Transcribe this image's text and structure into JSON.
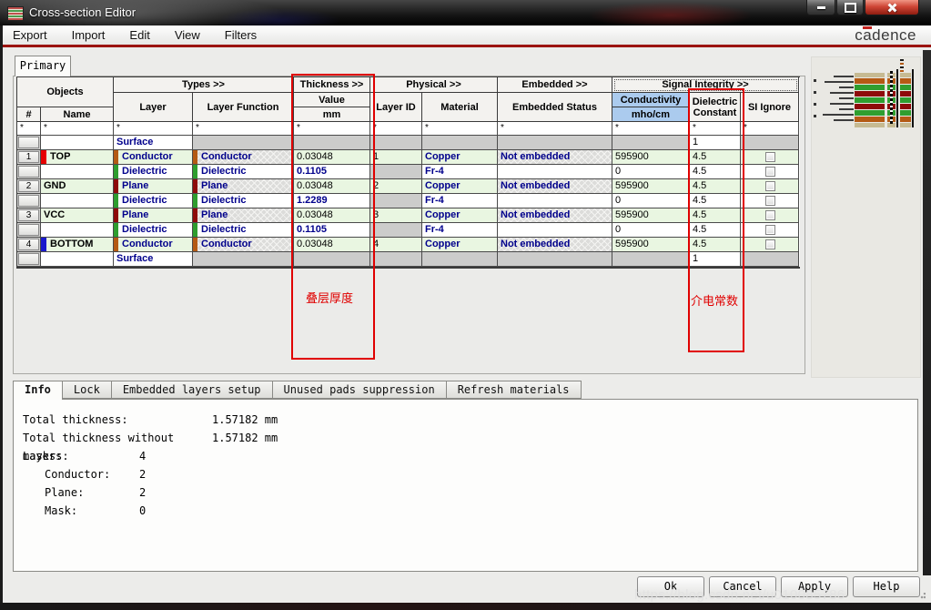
{
  "window": {
    "title": "Cross-section Editor"
  },
  "menu": {
    "items": [
      "Export",
      "Import",
      "Edit",
      "View",
      "Filters"
    ],
    "brand": "cadence"
  },
  "primary_tab": "Primary",
  "table": {
    "groups": {
      "objects": "Objects",
      "types": "Types >>",
      "thickness": "Thickness >>",
      "physical": "Physical >>",
      "embedded": "Embedded >>",
      "signal": "Signal Integrity >>"
    },
    "headers": {
      "num": "#",
      "name": "Name",
      "layer": "Layer",
      "layer_function": "Layer Function",
      "value": "Value",
      "unit": "mm",
      "layer_id": "Layer ID",
      "material": "Material",
      "embedded_status": "Embedded Status",
      "conductivity": "Conductivity",
      "conductivity_unit": "mho/cm",
      "dielectric_constant": "Dielectric Constant",
      "si_ignore": "SI Ignore"
    },
    "filter_char": "*",
    "rows": [
      {
        "num": "",
        "name": "",
        "layer": "Surface",
        "layer_function": "",
        "value": "",
        "layer_id": "",
        "material": "",
        "embedded_status": "",
        "conductivity": "",
        "dielectric": "1"
      },
      {
        "num": "1",
        "name": "TOP",
        "layer": "Conductor",
        "layer_function": "Conductor",
        "value": "0.03048",
        "layer_id": "1",
        "material": "Copper",
        "embedded_status": "Not embedded",
        "conductivity": "595900",
        "dielectric": "4.5"
      },
      {
        "num": "",
        "name": "",
        "layer": "Dielectric",
        "layer_function": "Dielectric",
        "value": "0.1105",
        "layer_id": "",
        "material": "Fr-4",
        "embedded_status": "",
        "conductivity": "0",
        "dielectric": "4.5"
      },
      {
        "num": "2",
        "name": "GND",
        "layer": "Plane",
        "layer_function": "Plane",
        "value": "0.03048",
        "layer_id": "2",
        "material": "Copper",
        "embedded_status": "Not embedded",
        "conductivity": "595900",
        "dielectric": "4.5"
      },
      {
        "num": "",
        "name": "",
        "layer": "Dielectric",
        "layer_function": "Dielectric",
        "value": "1.2289",
        "layer_id": "",
        "material": "Fr-4",
        "embedded_status": "",
        "conductivity": "0",
        "dielectric": "4.5"
      },
      {
        "num": "3",
        "name": "VCC",
        "layer": "Plane",
        "layer_function": "Plane",
        "value": "0.03048",
        "layer_id": "3",
        "material": "Copper",
        "embedded_status": "Not embedded",
        "conductivity": "595900",
        "dielectric": "4.5"
      },
      {
        "num": "",
        "name": "",
        "layer": "Dielectric",
        "layer_function": "Dielectric",
        "value": "0.1105",
        "layer_id": "",
        "material": "Fr-4",
        "embedded_status": "",
        "conductivity": "0",
        "dielectric": "4.5"
      },
      {
        "num": "4",
        "name": "BOTTOM",
        "layer": "Conductor",
        "layer_function": "Conductor",
        "value": "0.03048",
        "layer_id": "4",
        "material": "Copper",
        "embedded_status": "Not embedded",
        "conductivity": "595900",
        "dielectric": "4.5"
      },
      {
        "num": "",
        "name": "",
        "layer": "Surface",
        "layer_function": "",
        "value": "",
        "layer_id": "",
        "material": "",
        "embedded_status": "",
        "conductivity": "",
        "dielectric": "1"
      }
    ]
  },
  "annotations": {
    "thickness_label": "叠层厚度",
    "dielectric_label": "介电常数"
  },
  "bottom_tabs": [
    "Info",
    "Lock",
    "Embedded layers setup",
    "Unused pads suppression",
    "Refresh materials"
  ],
  "info": {
    "rows": [
      {
        "label": "Total thickness:",
        "value": "1.57182 mm"
      },
      {
        "label": "Total thickness without masks:",
        "value": "1.57182 mm"
      },
      {
        "label": "Layers:",
        "value": "4"
      },
      {
        "label": "Conductor:",
        "value": "2"
      },
      {
        "label": "Plane:",
        "value": "2"
      },
      {
        "label": "Mask:",
        "value": "0"
      }
    ]
  },
  "action_buttons": [
    "Ok",
    "Cancel",
    "Apply",
    "Help"
  ],
  "watermark": "https://blog.csdn.net/u010085786",
  "colors": {
    "conductor_strip": "#b45a14",
    "dielectric_strip": "#2f9e2f",
    "plane_strip": "#8e0a0a",
    "surface_bar": "#c6ba92",
    "top_chip": "#e60000",
    "bottom_chip": "#1a1acc",
    "row_green": "#e9f6e1",
    "conductivity_header": "#abcbee",
    "navy_text": "#00008c",
    "annotation_red": "#e00000",
    "menubar_accent": "#9b1310"
  }
}
